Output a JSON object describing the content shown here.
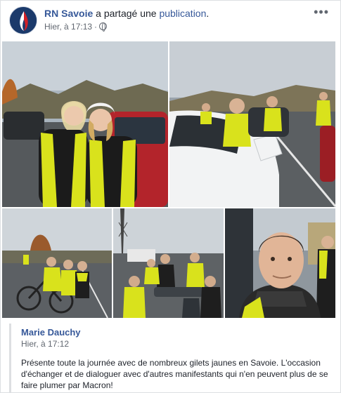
{
  "post": {
    "author": "RN Savoie",
    "action": " a partagé une ",
    "action_link": "publication",
    "action_end": ".",
    "time": "Hier, à 17:13",
    "more_label": "•••"
  },
  "shared": {
    "author": "Marie Dauchy",
    "time": "Hier, à 17:12",
    "text": "Présente toute la journée avec de nombreux gilets jaunes en Savoie. L'occasion d'échanger et de dialoguer avec d'autres manifestants qui n'en peuvent plus de se faire plumer par Macron!"
  },
  "icons": {
    "avatar": "rn-flame-logo",
    "audience": "globe-icon",
    "menu": "more-options-icon"
  },
  "colors": {
    "link": "#365899",
    "text": "#1d2129",
    "meta": "#616770",
    "vest": "#d9e21c",
    "logo_bg": "#1b3a6b",
    "logo_red": "#d32027"
  }
}
